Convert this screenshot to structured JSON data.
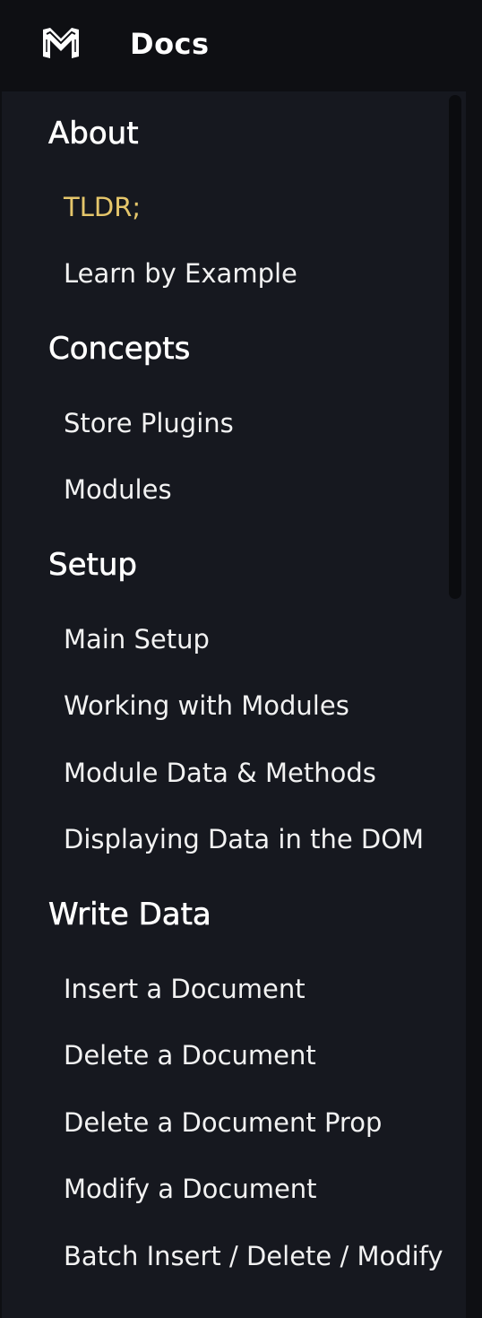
{
  "header": {
    "logo_icon": "m-shield-logo-icon",
    "title": "Docs"
  },
  "colors": {
    "background": "#16181f",
    "header_background": "#0e0f13",
    "active_item": "#e5c66b",
    "text": "#f2f2f2"
  },
  "sidebar": {
    "sections": [
      {
        "title": "About",
        "items": [
          {
            "label": "TLDR;",
            "active": true
          },
          {
            "label": "Learn by Example",
            "active": false
          }
        ]
      },
      {
        "title": "Concepts",
        "items": [
          {
            "label": "Store Plugins",
            "active": false
          },
          {
            "label": "Modules",
            "active": false
          }
        ]
      },
      {
        "title": "Setup",
        "items": [
          {
            "label": "Main Setup",
            "active": false
          },
          {
            "label": "Working with Modules",
            "active": false
          },
          {
            "label": "Module Data & Methods",
            "active": false
          },
          {
            "label": "Displaying Data in the DOM",
            "active": false
          }
        ]
      },
      {
        "title": "Write Data",
        "items": [
          {
            "label": "Insert a Document",
            "active": false
          },
          {
            "label": "Delete a Document",
            "active": false
          },
          {
            "label": "Delete a Document Prop",
            "active": false
          },
          {
            "label": "Modify a Document",
            "active": false
          },
          {
            "label": "Batch Insert / Delete / Modify",
            "active": false
          }
        ]
      }
    ]
  }
}
